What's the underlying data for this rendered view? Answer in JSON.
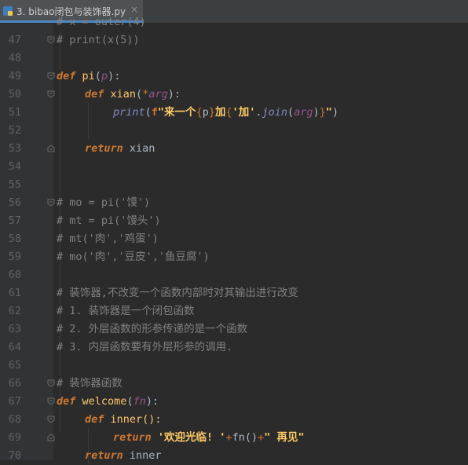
{
  "tab": {
    "title": "3. bibao闭包与装饰器.py",
    "close": "×"
  },
  "lines": [
    {
      "n": "47",
      "t": "# print(x(5))"
    },
    {
      "n": "48"
    },
    {
      "n": "49",
      "def_kw": "def",
      "name": "pi",
      "p_open": "(",
      "param": "p",
      "p_close": "):"
    },
    {
      "n": "50",
      "def_kw": "def",
      "name": "xian",
      "p_open": "(",
      "star": "*",
      "param": "arg",
      "p_close": "):"
    },
    {
      "n": "51",
      "bi": "print",
      "o": "(",
      "f": "f",
      "s1": "\"来一个",
      "b1": "{",
      "v1": "p",
      "b2": "}",
      "s2": "加",
      "b3": "{",
      "s3": "'加'",
      "dot": ".",
      "m": "join",
      "o2": "(",
      "a": "arg",
      "c2": ")",
      "b4": "}",
      "s4": "\"",
      "c": ")"
    },
    {
      "n": "52"
    },
    {
      "n": "53",
      "kw": "return",
      "rest": " xian"
    },
    {
      "n": "54"
    },
    {
      "n": "55"
    },
    {
      "n": "56",
      "t": "# mo = pi('馍')"
    },
    {
      "n": "57",
      "t": "# mt = pi('馒头')"
    },
    {
      "n": "58",
      "t": "# mt('肉','鸡蛋')"
    },
    {
      "n": "59",
      "t": "# mo('肉','豆皮','鱼豆腐')"
    },
    {
      "n": "60"
    },
    {
      "n": "61",
      "t": "# 装饰器,不改变一个函数内部时对其输出进行改变"
    },
    {
      "n": "62",
      "t": "# 1. 装饰器是一个闭包函数"
    },
    {
      "n": "63",
      "t": "# 2. 外层函数的形参传递的是一个函数"
    },
    {
      "n": "64",
      "t": "# 3. 内层函数要有外层形参的调用."
    },
    {
      "n": "65"
    },
    {
      "n": "66",
      "t": "# 装饰器函数"
    },
    {
      "n": "67",
      "def_kw": "def",
      "name": "welcome",
      "p_open": "(",
      "param": "fn",
      "p_close": "):"
    },
    {
      "n": "68",
      "def_kw": "def",
      "name": "inner",
      "p_open": "():"
    },
    {
      "n": "69",
      "kw": "return",
      "s1": "'欢迎光临! '",
      "op1": "+",
      "call": "fn()",
      "op2": "+",
      "s2": "\" 再见\""
    },
    {
      "n": "70",
      "kw": "return",
      "rest": " inner"
    }
  ],
  "colors": {
    "background": "#2b2b2b",
    "gutter": "#313335",
    "keyword": "#cc7832",
    "function": "#ffc66d",
    "parameter": "#94558d",
    "builtin": "#8888c6",
    "string": "#6a8759",
    "comment": "#808080",
    "default": "#a9b7c6",
    "tab_underline": "#4a88c7"
  },
  "icons": {
    "file": "python-file-icon",
    "fold": "fold-marker-icon"
  }
}
